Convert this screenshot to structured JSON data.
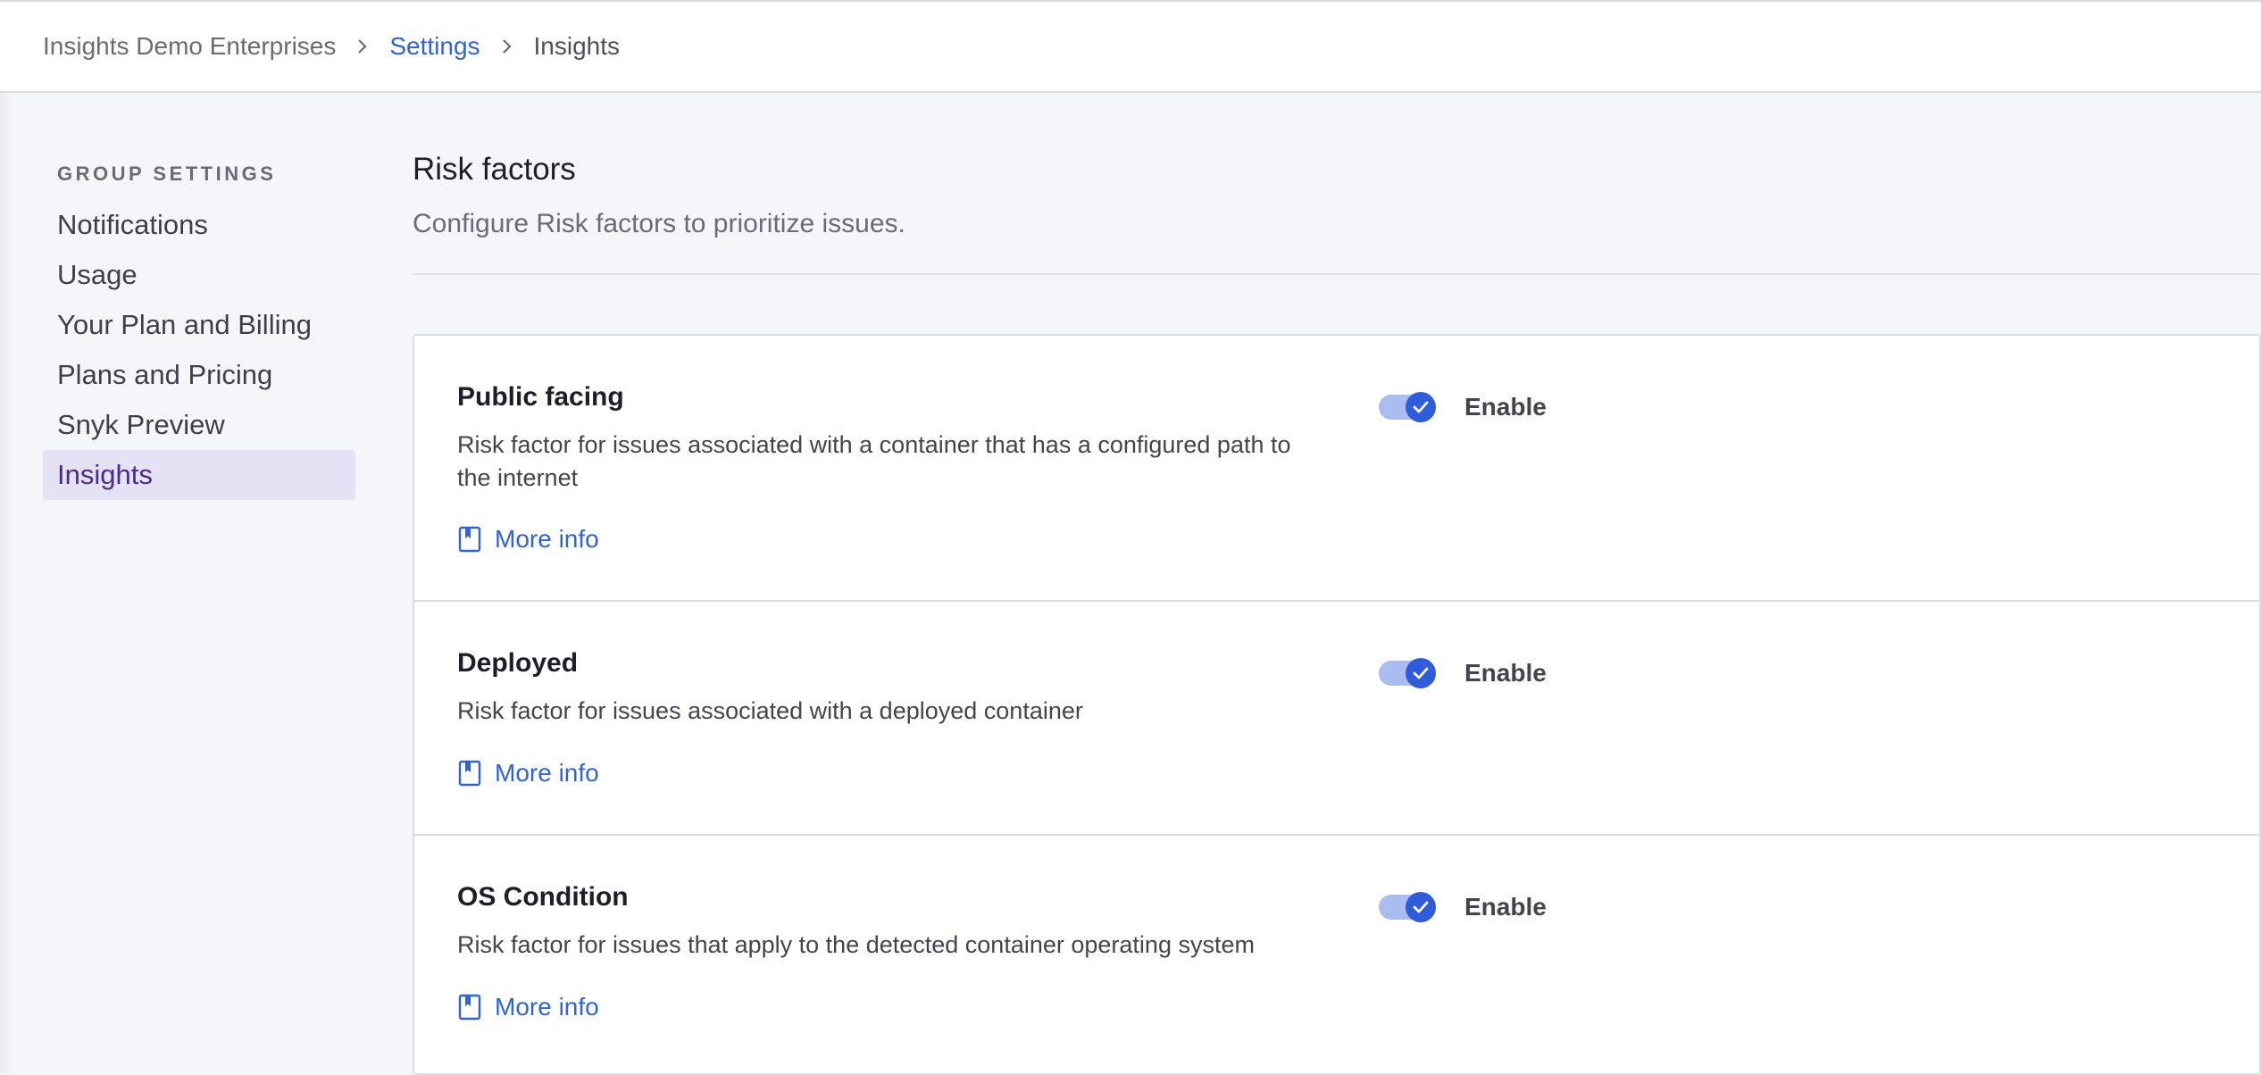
{
  "breadcrumb": {
    "org": "Insights Demo Enterprises",
    "section": "Settings",
    "current": "Insights"
  },
  "sidebar": {
    "heading": "GROUP SETTINGS",
    "items": [
      {
        "label": "Notifications"
      },
      {
        "label": "Usage"
      },
      {
        "label": "Your Plan and Billing"
      },
      {
        "label": "Plans and Pricing"
      },
      {
        "label": "Snyk Preview"
      },
      {
        "label": "Insights",
        "active": true
      }
    ]
  },
  "page": {
    "title": "Risk factors",
    "subtitle": "Configure Risk factors to prioritize issues."
  },
  "risk_factors": [
    {
      "title": "Public facing",
      "description": "Risk factor for issues associated with a container that has a configured path to the internet",
      "link": "More info",
      "toggle_label": "Enable",
      "enabled": true
    },
    {
      "title": "Deployed",
      "description": "Risk factor for issues associated with a deployed container",
      "link": "More info",
      "toggle_label": "Enable",
      "enabled": true
    },
    {
      "title": "OS Condition",
      "description": "Risk factor for issues that apply to the detected container operating system",
      "link": "More info",
      "toggle_label": "Enable",
      "enabled": true
    }
  ],
  "colors": {
    "accent": "#2f63d6",
    "active_nav_bg": "#e6e2f5",
    "active_nav_text": "#4a2d8a"
  }
}
